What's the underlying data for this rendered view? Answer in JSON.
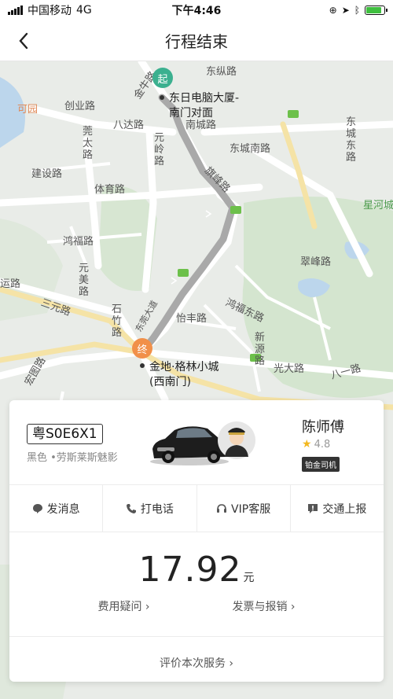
{
  "status_bar": {
    "carrier": "中国移动",
    "network": "4G",
    "time": "下午4:46"
  },
  "nav": {
    "title": "行程结束"
  },
  "map": {
    "roads": [
      "东纵路",
      "东日电脑大厦-南门对面",
      "金牛路",
      "创业路",
      "八达路",
      "南城路",
      "东城南路",
      "东城东路",
      "旗峰路",
      "星河城",
      "建设路",
      "体育路",
      "莞太路",
      "元岭路",
      "可园",
      "鸿福路",
      "元美路",
      "运路",
      "翠峰路",
      "石竹路",
      "怡丰路",
      "鸿福东路",
      "新源路",
      "光大路",
      "八一路",
      "宏图路",
      "东莞大道",
      "三元路"
    ],
    "start_label": "起",
    "start_address": "东日电脑大厦-\n南门对面",
    "end_label": "终",
    "end_address": "金地·格林小城\n(西南门)"
  },
  "driver": {
    "plate": "粤S0E6X1",
    "car_desc": "黑色 •劳斯莱斯魅影",
    "name": "陈师傅",
    "rating": "4.8",
    "level": "铂金司机"
  },
  "actions": [
    {
      "label": "发消息",
      "icon": "message-icon"
    },
    {
      "label": "打电话",
      "icon": "phone-icon"
    },
    {
      "label": "VIP客服",
      "icon": "headset-icon"
    },
    {
      "label": "交通上报",
      "icon": "report-icon"
    }
  ],
  "fare": {
    "amount": "17.92",
    "unit": "元",
    "question_link": "费用疑问",
    "invoice_link": "发票与报销",
    "rate_link": "评价本次服务"
  },
  "colors": {
    "route": "#a9a9a9",
    "start_pin": "#3bb08f",
    "end_pin": "#f19049",
    "battery": "#3fbf3f"
  }
}
